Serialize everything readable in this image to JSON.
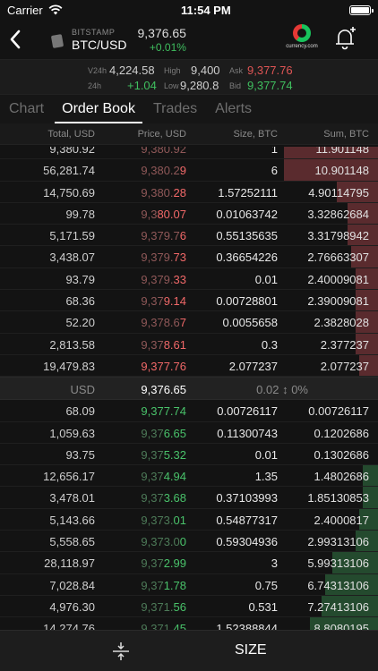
{
  "status_bar": {
    "carrier": "Carrier",
    "time": "11:54 PM"
  },
  "header": {
    "exchange": "BITSTAMP",
    "pair": "BTC/USD",
    "price": "9,376.65",
    "change": "+0.01%",
    "logo_text": "currency.com"
  },
  "stats": {
    "v24h_label": "V24h",
    "v24h": "4,224.58",
    "h24_label": "24h",
    "h24": "+1.04",
    "high_label": "High",
    "high": "9,400",
    "low_label": "Low",
    "low": "9,280.8",
    "ask_label": "Ask",
    "ask": "9,377.76",
    "bid_label": "Bid",
    "bid": "9,377.74"
  },
  "tabs": [
    "Chart",
    "Order Book",
    "Trades",
    "Alerts"
  ],
  "active_tab": "Order Book",
  "columns": {
    "total": "Total, USD",
    "price": "Price, USD",
    "size": "Size, BTC",
    "sum": "Sum, BTC"
  },
  "asks": [
    {
      "total": "9,380.92",
      "price_dim": "9,380.92",
      "price_hi": "",
      "size": "1",
      "sum": "11.901148",
      "depth": 0.25
    },
    {
      "total": "56,281.74",
      "price_dim": "9,380.2",
      "price_hi": "9",
      "size": "6",
      "sum": "10.901148",
      "depth": 0.25
    },
    {
      "total": "14,750.69",
      "price_dim": "9,380.",
      "price_hi": "28",
      "size": "1.57252111",
      "sum": "4.90114795",
      "depth": 0.11
    },
    {
      "total": "99.78",
      "price_dim": "9,3",
      "price_hi": "80.07",
      "size": "0.01063742",
      "sum": "3.32862684",
      "depth": 0.08
    },
    {
      "total": "5,171.59",
      "price_dim": "9,379.7",
      "price_hi": "6",
      "size": "0.55135635",
      "sum": "3.31798942",
      "depth": 0.08
    },
    {
      "total": "3,438.07",
      "price_dim": "9,379.",
      "price_hi": "73",
      "size": "0.36654226",
      "sum": "2.76663307",
      "depth": 0.07
    },
    {
      "total": "93.79",
      "price_dim": "9,379.",
      "price_hi": "33",
      "size": "0.01",
      "sum": "2.40009081",
      "depth": 0.06
    },
    {
      "total": "68.36",
      "price_dim": "9,37",
      "price_hi": "9.14",
      "size": "0.00728801",
      "sum": "2.39009081",
      "depth": 0.06
    },
    {
      "total": "52.20",
      "price_dim": "9,378.6",
      "price_hi": "7",
      "size": "0.0055658",
      "sum": "2.3828028",
      "depth": 0.06
    },
    {
      "total": "2,813.58",
      "price_dim": "9,37",
      "price_hi": "8.61",
      "size": "0.3",
      "sum": "2.377237",
      "depth": 0.06
    },
    {
      "total": "19,479.83",
      "price_dim": "",
      "price_hi": "9,377.76",
      "size": "2.077237",
      "sum": "2.077237",
      "depth": 0.05
    }
  ],
  "mid": {
    "currency": "USD",
    "price": "9,376.65",
    "spread": "0.02 ↕ 0%"
  },
  "bids": [
    {
      "total": "68.09",
      "price_dim": "",
      "price_hi": "9,377.74",
      "size": "0.00726117",
      "sum": "0.00726117",
      "depth": 0.0
    },
    {
      "total": "1,059.63",
      "price_dim": "9,37",
      "price_hi": "6.65",
      "size": "0.11300743",
      "sum": "0.1202686",
      "depth": 0.0
    },
    {
      "total": "93.75",
      "price_dim": "9,37",
      "price_hi": "5.32",
      "size": "0.01",
      "sum": "0.1302686",
      "depth": 0.0
    },
    {
      "total": "12,656.17",
      "price_dim": "9,37",
      "price_hi": "4.94",
      "size": "1.35",
      "sum": "1.4802686",
      "depth": 0.04
    },
    {
      "total": "3,478.01",
      "price_dim": "9,37",
      "price_hi": "3.68",
      "size": "0.37103993",
      "sum": "1.85130853",
      "depth": 0.04
    },
    {
      "total": "5,143.66",
      "price_dim": "9,373.",
      "price_hi": "01",
      "size": "0.54877317",
      "sum": "2.4000817",
      "depth": 0.05
    },
    {
      "total": "5,558.65",
      "price_dim": "9,373.0",
      "price_hi": "0",
      "size": "0.59304936",
      "sum": "2.99313106",
      "depth": 0.06
    },
    {
      "total": "28,118.97",
      "price_dim": "9,37",
      "price_hi": "2.99",
      "size": "3",
      "sum": "5.99313106",
      "depth": 0.12
    },
    {
      "total": "7,028.84",
      "price_dim": "9,37",
      "price_hi": "1.78",
      "size": "0.75",
      "sum": "6.74313106",
      "depth": 0.14
    },
    {
      "total": "4,976.30",
      "price_dim": "9,371.",
      "price_hi": "56",
      "size": "0.531",
      "sum": "7.27413106",
      "depth": 0.15
    },
    {
      "total": "14,274.76",
      "price_dim": "9,371.",
      "price_hi": "45",
      "size": "1.52388844",
      "sum": "8.8080195",
      "depth": 0.18
    }
  ],
  "toolbar": {
    "size_label": "SIZE"
  },
  "colors": {
    "ask": "#e05555",
    "bid": "#3fbf5f",
    "background": "#131313"
  }
}
